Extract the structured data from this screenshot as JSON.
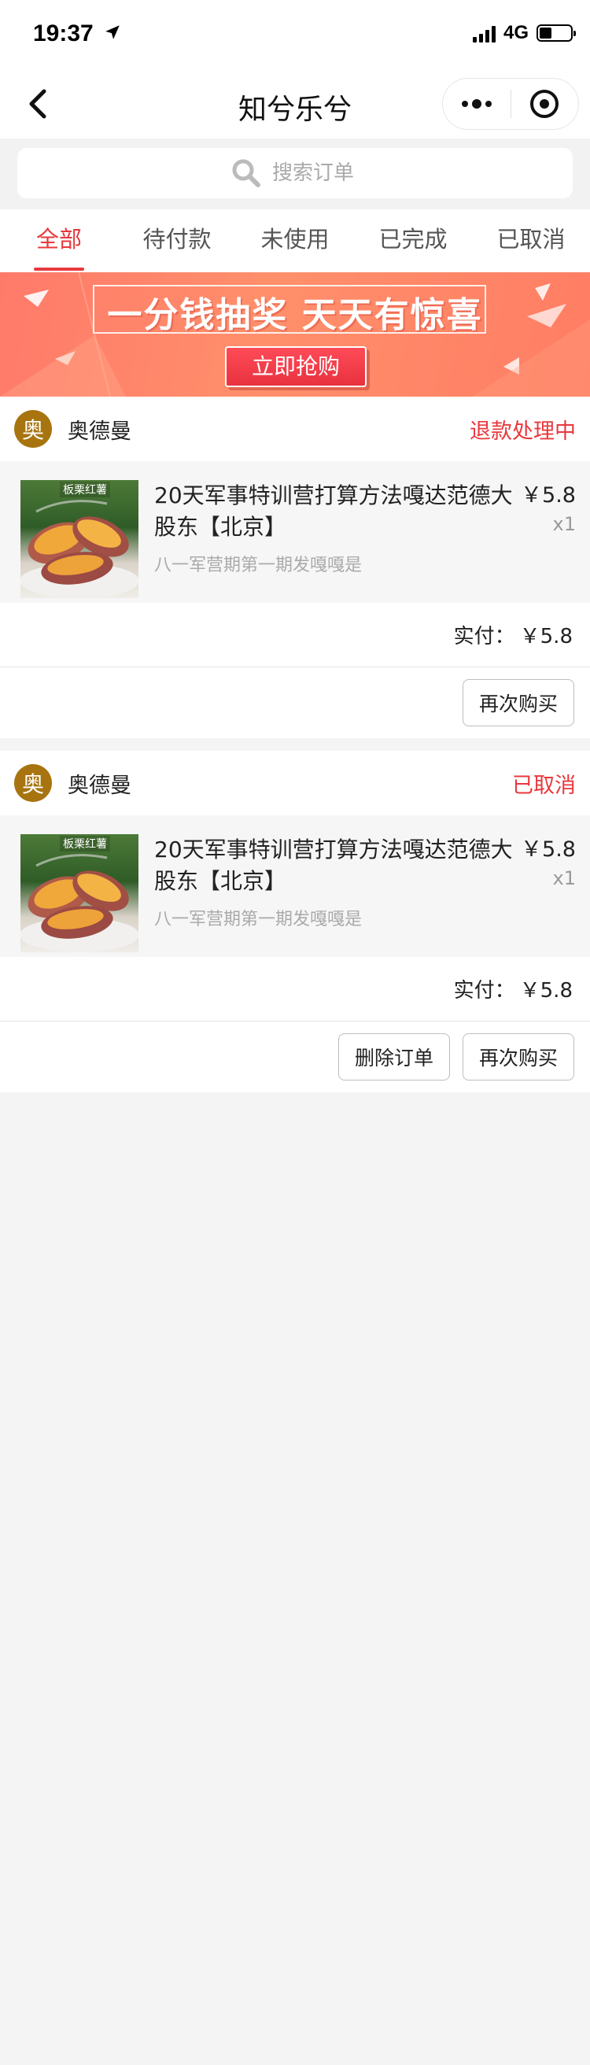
{
  "status_bar": {
    "time": "19:37",
    "network": "4G"
  },
  "nav": {
    "title": "知兮乐兮"
  },
  "search": {
    "placeholder": "搜索订单"
  },
  "tabs": [
    {
      "label": "全部",
      "active": true
    },
    {
      "label": "待付款"
    },
    {
      "label": "未使用"
    },
    {
      "label": "已完成"
    },
    {
      "label": "已取消"
    }
  ],
  "banner": {
    "title": "一分钱抽奖 天天有惊喜",
    "button": "立即抢购"
  },
  "orders": [
    {
      "shop_initial": "奥",
      "shop_name": "奥德曼",
      "status": "退款处理中",
      "item": {
        "title": "20天军事特训营打算方法嘎达范德大股东【北京】",
        "spec": "八一军营期第一期发嘎嘎是",
        "price": "￥5.8",
        "qty": "x1",
        "thumb_label": "板栗红薯"
      },
      "paid_label": "实付：",
      "paid_amount": "￥5.8",
      "actions": [
        "再次购买"
      ]
    },
    {
      "shop_initial": "奥",
      "shop_name": "奥德曼",
      "status": "已取消",
      "item": {
        "title": "20天军事特训营打算方法嘎达范德大股东【北京】",
        "spec": "八一军营期第一期发嘎嘎是",
        "price": "￥5.8",
        "qty": "x1",
        "thumb_label": "板栗红薯"
      },
      "paid_label": "实付：",
      "paid_amount": "￥5.8",
      "actions": [
        "删除订单",
        "再次购买"
      ]
    }
  ],
  "colors": {
    "accent": "#e8383d",
    "shop_avatar": "#a8740f",
    "background": "#f4f4f4"
  },
  "icons": [
    "location-arrow-icon",
    "signal-icon",
    "battery-icon",
    "back-arrow-icon",
    "more-dots-icon",
    "target-icon",
    "search-icon"
  ]
}
